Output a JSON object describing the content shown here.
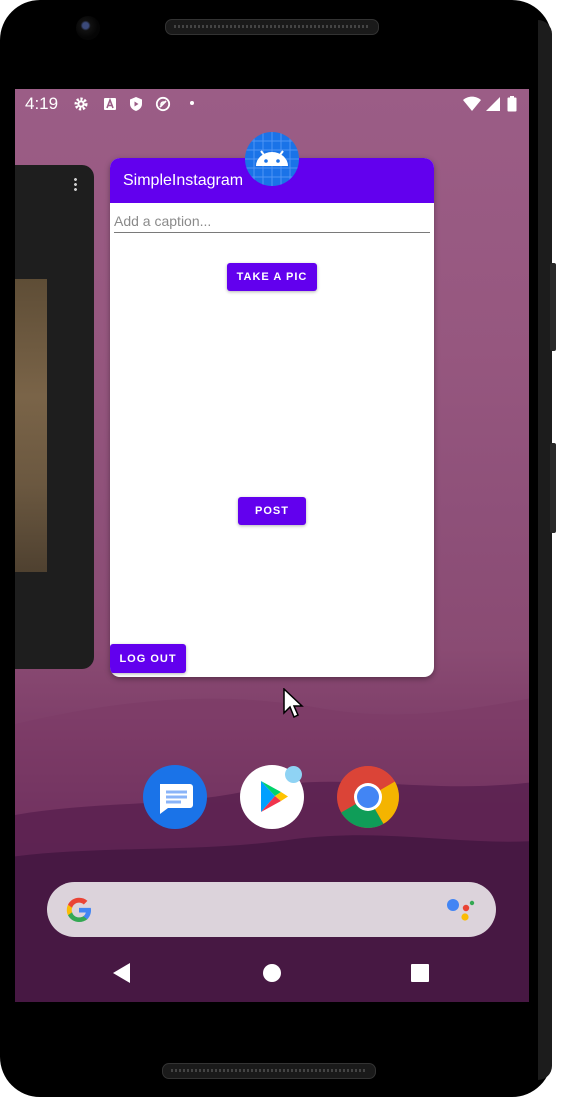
{
  "status_bar": {
    "time": "4:19",
    "left_icons": [
      "settings-gear-icon",
      "a-square-icon",
      "play-protect-icon",
      "no-sim-icon",
      "dot-icon"
    ],
    "right_icons": [
      "wifi-icon",
      "cell-signal-icon",
      "battery-icon"
    ]
  },
  "recent_app": {
    "title": "SimpleInstagram",
    "caption_placeholder": "Add a caption...",
    "caption_value": "",
    "take_pic_label": "TAKE A PIC",
    "post_label": "POST",
    "logout_label": "LOG OUT",
    "accent_color": "#6200ee"
  },
  "dock": {
    "apps": [
      "messages-icon",
      "play-store-icon",
      "chrome-icon"
    ]
  },
  "search_bar": {
    "left_icon": "google-g-icon",
    "right_icon": "google-assistant-icon"
  },
  "nav_bar": {
    "buttons": [
      "back-icon",
      "home-icon",
      "recents-icon"
    ]
  }
}
